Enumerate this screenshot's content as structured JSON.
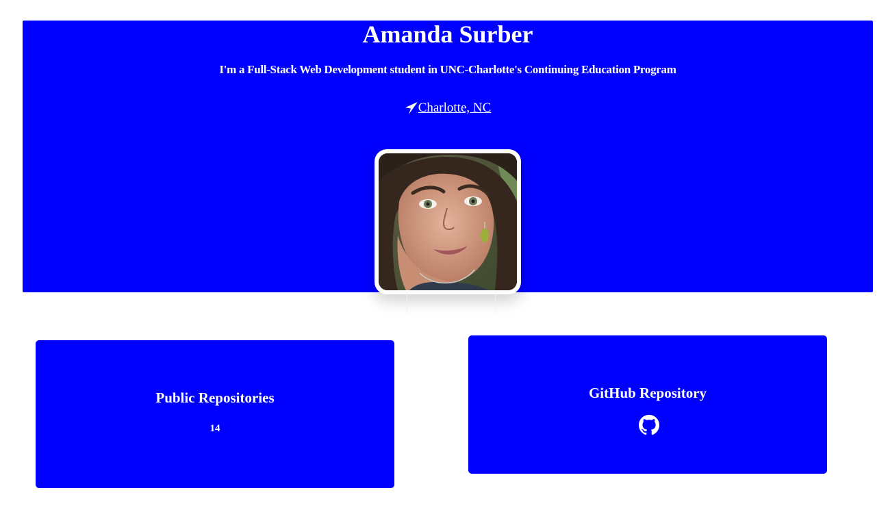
{
  "header": {
    "name": "Amanda Surber",
    "tagline": "I'm a Full-Stack Web Development student in UNC-Charlotte's Continuing Education Program",
    "location": "Charlotte, NC",
    "location_icon": "location-arrow-icon",
    "avatar_alt": "Amanda Surber"
  },
  "cards": {
    "repos": {
      "title": "Public Repositories",
      "count": "14"
    },
    "github": {
      "title": "GitHub Repository",
      "icon": "github-icon"
    }
  },
  "colors": {
    "primary": "#0000ff",
    "text": "#ffffff",
    "background": "#ffffff"
  }
}
